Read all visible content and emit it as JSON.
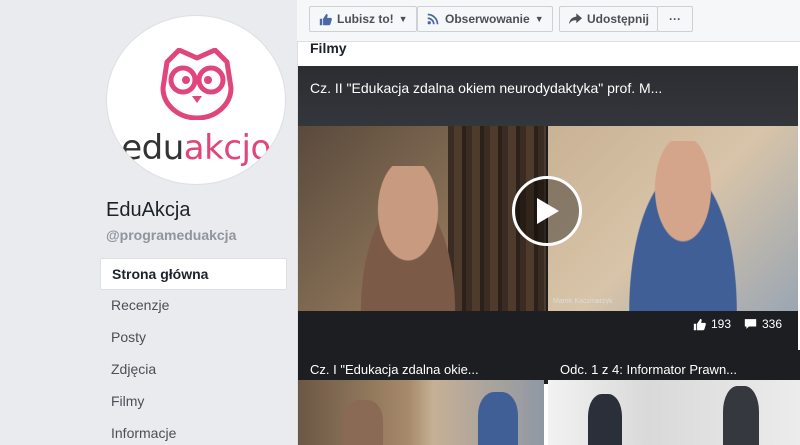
{
  "page": {
    "brand_prefix": "edu",
    "brand_suffix": "akcjo",
    "name": "EduAkcja",
    "handle": "@programeduakcja",
    "accent": "#e0457b"
  },
  "nav": {
    "items": [
      {
        "label": "Strona główna"
      },
      {
        "label": "Recenzje"
      },
      {
        "label": "Posty"
      },
      {
        "label": "Zdjęcia"
      },
      {
        "label": "Filmy"
      },
      {
        "label": "Informacje"
      }
    ]
  },
  "actions": {
    "like": "Lubisz to!",
    "follow": "Obserwowanie",
    "share": "Udostępnij",
    "more": "···"
  },
  "content": {
    "section_title": "Filmy",
    "main_video": {
      "title": "Cz. II \"Edukacja zdalna okiem neurodydaktyka\" prof. M...",
      "caption_tag": "Marek Kaczmarzyk",
      "likes": "193",
      "comments": "336"
    },
    "thumbs": [
      {
        "title": "Cz. I \"Edukacja zdalna okie..."
      },
      {
        "title": "Odc. 1 z 4: Informator Prawn..."
      }
    ]
  }
}
